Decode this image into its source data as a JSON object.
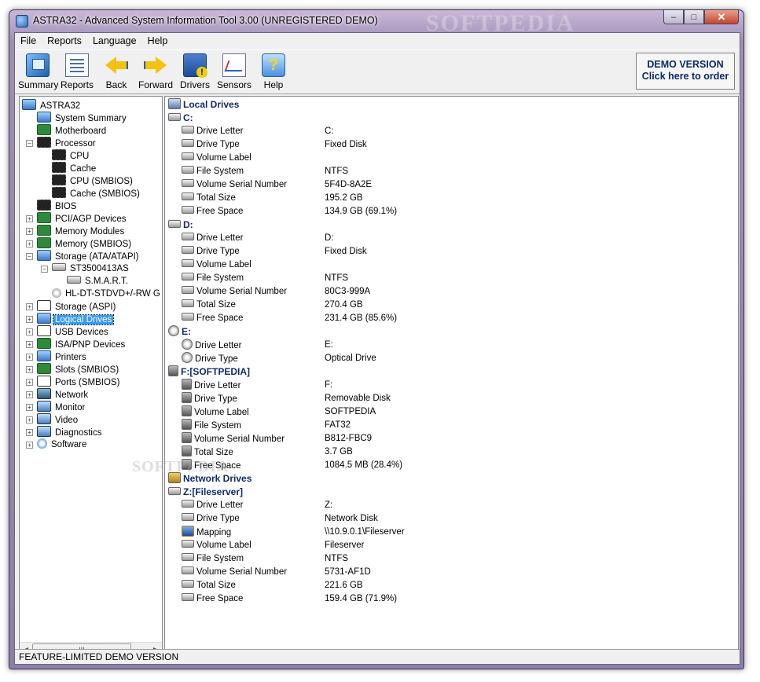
{
  "window": {
    "title": "ASTRA32 - Advanced System Information Tool 3.00 (UNREGISTERED DEMO)",
    "watermark": "SOFTPEDIA",
    "controls": {
      "minimize": "–",
      "maximize": "□",
      "close": "✕"
    }
  },
  "menu": [
    "File",
    "Reports",
    "Language",
    "Help"
  ],
  "toolbar": {
    "buttons": [
      {
        "label": "Summary",
        "icon": "summary-icon"
      },
      {
        "label": "Reports",
        "icon": "reports-icon"
      },
      {
        "label": "Back",
        "icon": "back-arrow-icon"
      },
      {
        "label": "Forward",
        "icon": "forward-arrow-icon"
      },
      {
        "label": "Drivers",
        "icon": "drivers-icon"
      },
      {
        "label": "Sensors",
        "icon": "sensors-icon"
      },
      {
        "label": "Help",
        "icon": "help-icon"
      }
    ],
    "demo_line1": "DEMO VERSION",
    "demo_line2": "Click here to order"
  },
  "tree": [
    {
      "label": "ASTRA32",
      "level": 0,
      "icon": "computer"
    },
    {
      "label": "System Summary",
      "level": 1,
      "icon": "computer"
    },
    {
      "label": "Motherboard",
      "level": 1,
      "icon": "board"
    },
    {
      "label": "Processor",
      "level": 1,
      "icon": "chip",
      "expanded": true
    },
    {
      "label": "CPU",
      "level": 2,
      "icon": "chip"
    },
    {
      "label": "Cache",
      "level": 2,
      "icon": "chip"
    },
    {
      "label": "CPU (SMBIOS)",
      "level": 2,
      "icon": "chip"
    },
    {
      "label": "Cache (SMBIOS)",
      "level": 2,
      "icon": "chip"
    },
    {
      "label": "BIOS",
      "level": 1,
      "icon": "chip"
    },
    {
      "label": "PCI/AGP Devices",
      "level": 1,
      "icon": "board",
      "collapsed": true
    },
    {
      "label": "Memory Modules",
      "level": 1,
      "icon": "board",
      "collapsed": true
    },
    {
      "label": "Memory (SMBIOS)",
      "level": 1,
      "icon": "board",
      "collapsed": true
    },
    {
      "label": "Storage (ATA/ATAPI)",
      "level": 1,
      "icon": "computer",
      "expanded": true
    },
    {
      "label": "ST3500413AS",
      "level": 2,
      "icon": "disk",
      "expanded": true
    },
    {
      "label": "S.M.A.R.T.",
      "level": 3,
      "icon": "disk"
    },
    {
      "label": "HL-DT-STDVD+/-RW G",
      "level": 2,
      "icon": "cd"
    },
    {
      "label": "Storage (ASPI)",
      "level": 1,
      "icon": "usb",
      "collapsed": true
    },
    {
      "label": "Logical Drives",
      "level": 1,
      "icon": "computer",
      "collapsed": true,
      "selected": true
    },
    {
      "label": "USB Devices",
      "level": 1,
      "icon": "usb",
      "collapsed": true
    },
    {
      "label": "ISA/PNP Devices",
      "level": 1,
      "icon": "board",
      "collapsed": true
    },
    {
      "label": "Printers",
      "level": 1,
      "icon": "computer",
      "collapsed": true
    },
    {
      "label": "Slots (SMBIOS)",
      "level": 1,
      "icon": "board",
      "collapsed": true
    },
    {
      "label": "Ports (SMBIOS)",
      "level": 1,
      "icon": "usb",
      "collapsed": true
    },
    {
      "label": "Network",
      "level": 1,
      "icon": "net",
      "collapsed": true
    },
    {
      "label": "Monitor",
      "level": 1,
      "icon": "monitor",
      "collapsed": true
    },
    {
      "label": "Video",
      "level": 1,
      "icon": "monitor",
      "collapsed": true
    },
    {
      "label": "Diagnostics",
      "level": 1,
      "icon": "monitor",
      "collapsed": true
    },
    {
      "label": "Software",
      "level": 1,
      "icon": "disc",
      "collapsed": true
    }
  ],
  "details": [
    {
      "type": "section",
      "label": "Local Drives",
      "icon": "local"
    },
    {
      "type": "drive",
      "label": "C:",
      "icon": "disk"
    },
    {
      "type": "prop",
      "label": "Drive Letter",
      "value": "C:",
      "icon": "disk"
    },
    {
      "type": "prop",
      "label": "Drive Type",
      "value": "Fixed Disk",
      "icon": "disk"
    },
    {
      "type": "prop",
      "label": "Volume Label",
      "value": "",
      "icon": "disk"
    },
    {
      "type": "prop",
      "label": "File System",
      "value": "NTFS",
      "icon": "disk"
    },
    {
      "type": "prop",
      "label": "Volume Serial Number",
      "value": "5F4D-8A2E",
      "icon": "disk"
    },
    {
      "type": "prop",
      "label": "Total Size",
      "value": "195.2 GB",
      "icon": "disk"
    },
    {
      "type": "prop",
      "label": "Free Space",
      "value": "134.9 GB (69.1%)",
      "icon": "disk"
    },
    {
      "type": "drive",
      "label": "D:",
      "icon": "disk"
    },
    {
      "type": "prop",
      "label": "Drive Letter",
      "value": "D:",
      "icon": "disk"
    },
    {
      "type": "prop",
      "label": "Drive Type",
      "value": "Fixed Disk",
      "icon": "disk"
    },
    {
      "type": "prop",
      "label": "Volume Label",
      "value": "",
      "icon": "disk"
    },
    {
      "type": "prop",
      "label": "File System",
      "value": "NTFS",
      "icon": "disk"
    },
    {
      "type": "prop",
      "label": "Volume Serial Number",
      "value": "80C3-999A",
      "icon": "disk"
    },
    {
      "type": "prop",
      "label": "Total Size",
      "value": "270.4 GB",
      "icon": "disk"
    },
    {
      "type": "prop",
      "label": "Free Space",
      "value": "231.4 GB (85.6%)",
      "icon": "disk"
    },
    {
      "type": "drive",
      "label": "E:",
      "icon": "cd"
    },
    {
      "type": "prop",
      "label": "Drive Letter",
      "value": "E:",
      "icon": "cd"
    },
    {
      "type": "prop",
      "label": "Drive Type",
      "value": "Optical Drive",
      "icon": "cd"
    },
    {
      "type": "drive",
      "label": "F:[SOFTPEDIA]",
      "icon": "rem"
    },
    {
      "type": "prop",
      "label": "Drive Letter",
      "value": "F:",
      "icon": "rem"
    },
    {
      "type": "prop",
      "label": "Drive Type",
      "value": "Removable Disk",
      "icon": "rem"
    },
    {
      "type": "prop",
      "label": "Volume Label",
      "value": "SOFTPEDIA",
      "icon": "rem"
    },
    {
      "type": "prop",
      "label": "File System",
      "value": "FAT32",
      "icon": "rem"
    },
    {
      "type": "prop",
      "label": "Volume Serial Number",
      "value": "B812-FBC9",
      "icon": "rem"
    },
    {
      "type": "prop",
      "label": "Total Size",
      "value": "3.7 GB",
      "icon": "rem"
    },
    {
      "type": "prop",
      "label": "Free Space",
      "value": "1084.5 MB (28.4%)",
      "icon": "rem"
    },
    {
      "type": "section",
      "label": "Network Drives",
      "icon": "net"
    },
    {
      "type": "drive",
      "label": "Z:[Fileserver]",
      "icon": "disk"
    },
    {
      "type": "prop",
      "label": "Drive Letter",
      "value": "Z:",
      "icon": "disk"
    },
    {
      "type": "prop",
      "label": "Drive Type",
      "value": "Network Disk",
      "icon": "disk"
    },
    {
      "type": "prop",
      "label": "Mapping",
      "value": "\\\\10.9.0.1\\Fileserver",
      "icon": "map"
    },
    {
      "type": "prop",
      "label": "Volume Label",
      "value": "Fileserver",
      "icon": "disk"
    },
    {
      "type": "prop",
      "label": "File System",
      "value": "NTFS",
      "icon": "disk"
    },
    {
      "type": "prop",
      "label": "Volume Serial Number",
      "value": "5731-AF1D",
      "icon": "disk"
    },
    {
      "type": "prop",
      "label": "Total Size",
      "value": "221.6 GB",
      "icon": "disk"
    },
    {
      "type": "prop",
      "label": "Free Space",
      "value": "159.4 GB (71.9%)",
      "icon": "disk"
    }
  ],
  "tree_scroll_label": "III",
  "watermark_mid": "SOFTPEDIA",
  "status": "FEATURE-LIMITED DEMO VERSION"
}
